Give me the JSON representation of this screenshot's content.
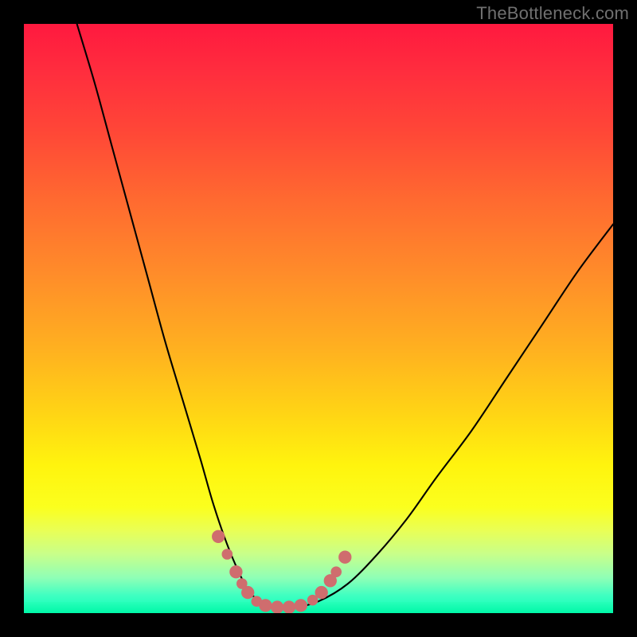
{
  "watermark": "TheBottleneck.com",
  "colors": {
    "page_bg": "#000000",
    "watermark": "#707070",
    "curve": "#000000",
    "dots": "#cf6d6e",
    "gradient_top": "#ff193f",
    "gradient_bottom": "#0affb8"
  },
  "chart_data": {
    "type": "line",
    "title": "",
    "xlabel": "",
    "ylabel": "",
    "xlim": [
      0,
      100
    ],
    "ylim": [
      0,
      100
    ],
    "grid": false,
    "legend": false,
    "series": [
      {
        "name": "bottleneck-curve",
        "x": [
          9,
          12,
          15,
          18,
          21,
          24,
          27,
          30,
          32,
          34,
          36,
          38,
          40,
          42,
          46,
          50,
          55,
          60,
          65,
          70,
          76,
          82,
          88,
          94,
          100
        ],
        "y": [
          100,
          90,
          79,
          68,
          57,
          46,
          36,
          26,
          19,
          13,
          8,
          4,
          2,
          1,
          1,
          2,
          5,
          10,
          16,
          23,
          31,
          40,
          49,
          58,
          66
        ]
      }
    ],
    "markers": [
      {
        "x": 33.0,
        "y": 13.0,
        "r": 1.2
      },
      {
        "x": 34.5,
        "y": 10.0,
        "r": 1.0
      },
      {
        "x": 36.0,
        "y": 7.0,
        "r": 1.2
      },
      {
        "x": 37.0,
        "y": 5.0,
        "r": 1.0
      },
      {
        "x": 38.0,
        "y": 3.5,
        "r": 1.2
      },
      {
        "x": 39.5,
        "y": 2.0,
        "r": 1.0
      },
      {
        "x": 41.0,
        "y": 1.3,
        "r": 1.2
      },
      {
        "x": 43.0,
        "y": 1.0,
        "r": 1.2
      },
      {
        "x": 45.0,
        "y": 1.0,
        "r": 1.2
      },
      {
        "x": 47.0,
        "y": 1.3,
        "r": 1.2
      },
      {
        "x": 49.0,
        "y": 2.2,
        "r": 1.0
      },
      {
        "x": 50.5,
        "y": 3.5,
        "r": 1.2
      },
      {
        "x": 52.0,
        "y": 5.5,
        "r": 1.2
      },
      {
        "x": 53.0,
        "y": 7.0,
        "r": 1.0
      },
      {
        "x": 54.5,
        "y": 9.5,
        "r": 1.2
      }
    ],
    "notes": "Background is a vertical red→yellow→green gradient. Curve is a V-shaped bottleneck profile with pink dots clustered near the trough."
  }
}
